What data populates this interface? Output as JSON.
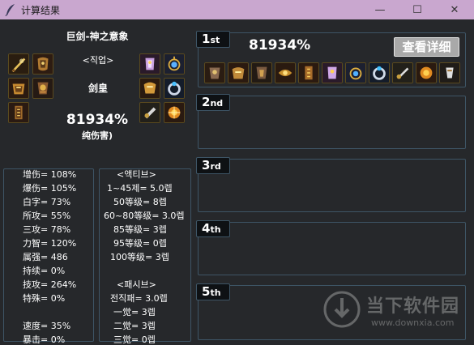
{
  "window": {
    "title": "计算结果",
    "controls": [
      "—",
      "☐",
      "✕"
    ]
  },
  "left_panel": {
    "title": "巨剑-神之意象",
    "job_label": "<직업>",
    "job": "剑皇",
    "percent": "81934%",
    "subtitle": "纯伤害)"
  },
  "equipment_icons_left": [
    "sword-icon",
    "armor-icon",
    "armor-icon",
    "armor-icon",
    "armor-icon",
    "armor-icon",
    "armor-icon"
  ],
  "equipment_icons_right": [
    "armor-icon",
    "amulet-icon",
    "armor-icon",
    "ring-icon",
    "bracelet-icon",
    "gem-icon"
  ],
  "stats": [
    "增伤= 108%",
    "爆伤= 105%",
    "白字= 73%",
    "所攻= 55%",
    "三攻= 78%",
    "力智= 120%",
    "属强= 486",
    "持续= 0%",
    "技攻= 264%",
    "特殊= 0%",
    "",
    "速度= 35%",
    "暴击= 0%"
  ],
  "skills": [
    "<액티브>",
    "1~45제= 5.0렙",
    "50等级= 8렙",
    "60~80等级= 3.0렙",
    "85等级= 3렙",
    "95等级= 0렙",
    "100等级= 3렙",
    "",
    "<패시브>",
    "전직패= 3.0렙",
    "一觉= 3렙",
    "二觉= 3렙",
    "三觉= 0렙"
  ],
  "ranks": [
    {
      "label": "1",
      "suffix": "st"
    },
    {
      "label": "2",
      "suffix": "nd"
    },
    {
      "label": "3",
      "suffix": "rd"
    },
    {
      "label": "4",
      "suffix": "th"
    },
    {
      "label": "5",
      "suffix": "th"
    }
  ],
  "first_result": {
    "percent": "81934%",
    "detail_button": "查看详细"
  },
  "watermark": {
    "brand": "当下软件园",
    "url": "www.downxia.com"
  }
}
